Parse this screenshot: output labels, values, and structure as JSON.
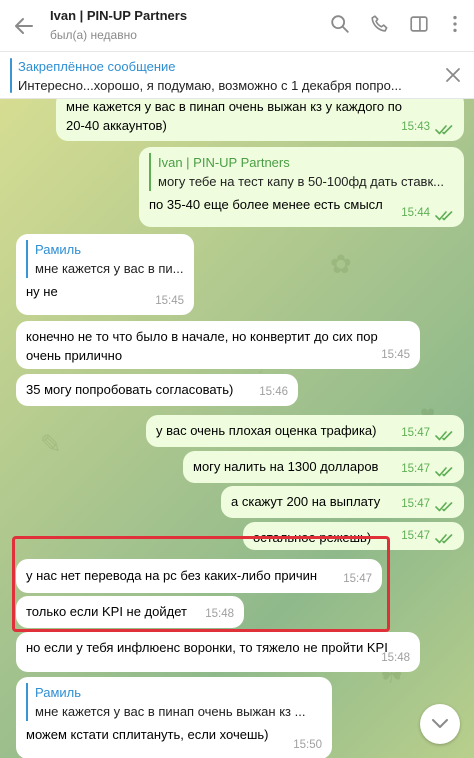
{
  "header": {
    "title": "Ivan | PIN-UP Partners",
    "status": "был(а) недавно"
  },
  "pinned": {
    "title": "Закреплённое сообщение",
    "text": "Интересно...хорошо, я подумаю, возможно с 1 декабря попро..."
  },
  "messages": [
    {
      "id": "m1",
      "dir": "out",
      "text": "мне кажется у вас в пинап очень выжан кз у каждого по 20-40 аккаунтов)",
      "time": "15:43"
    },
    {
      "id": "m2",
      "dir": "out",
      "quote_name": "Ivan | PIN-UP Partners",
      "quote_text": "могу тебе на тест капу в 50-100фд дать ставк...",
      "text": "по 35-40 еще более менее есть смысл",
      "time": "15:44"
    },
    {
      "id": "m3",
      "dir": "in",
      "quote_name": "Рамиль",
      "quote_text": "мне кажется у вас в пи...",
      "text": "ну не",
      "time": "15:45"
    },
    {
      "id": "m4",
      "dir": "in",
      "text": "конечно не то что было в начале, но конвертит до сих пор очень прилично",
      "time": "15:45"
    },
    {
      "id": "m5",
      "dir": "in",
      "text": "35 могу попробовать согласовать)",
      "time": "15:46"
    },
    {
      "id": "m6",
      "dir": "out",
      "text": "у вас очень плохая оценка трафика)",
      "time": "15:47"
    },
    {
      "id": "m7",
      "dir": "out",
      "text": "могу налить на 1300 долларов",
      "time": "15:47"
    },
    {
      "id": "m8",
      "dir": "out",
      "text": "а скажут 200 на выплату",
      "time": "15:47"
    },
    {
      "id": "m9",
      "dir": "out",
      "text": "остальное режешь)",
      "time": "15:47"
    },
    {
      "id": "m10",
      "dir": "in",
      "text": "у нас нет перевода на рс без каких-либо причин",
      "time": "15:47"
    },
    {
      "id": "m11",
      "dir": "in",
      "text": "только если KPI не дойдет",
      "time": "15:48"
    },
    {
      "id": "m12",
      "dir": "in",
      "text": "но если у тебя инфлюенс воронки, то тяжело не пройти KPI",
      "time": "15:48"
    },
    {
      "id": "m13",
      "dir": "in",
      "quote_name": "Рамиль",
      "quote_text": "мне кажется у вас в пинап очень выжан кз ...",
      "text": "можем кстати сплитануть, если хочешь)",
      "time": "15:50"
    }
  ],
  "colors": {
    "accent": "#3a95d5",
    "outgoing_bubble": "#effdde",
    "check_green": "#5fae55",
    "highlight_red": "#e0303a"
  },
  "icons": [
    "back-arrow-icon",
    "search-icon",
    "phone-icon",
    "sidebar-toggle-icon",
    "more-vertical-icon",
    "close-icon",
    "double-check-icon",
    "chevron-down-icon"
  ]
}
